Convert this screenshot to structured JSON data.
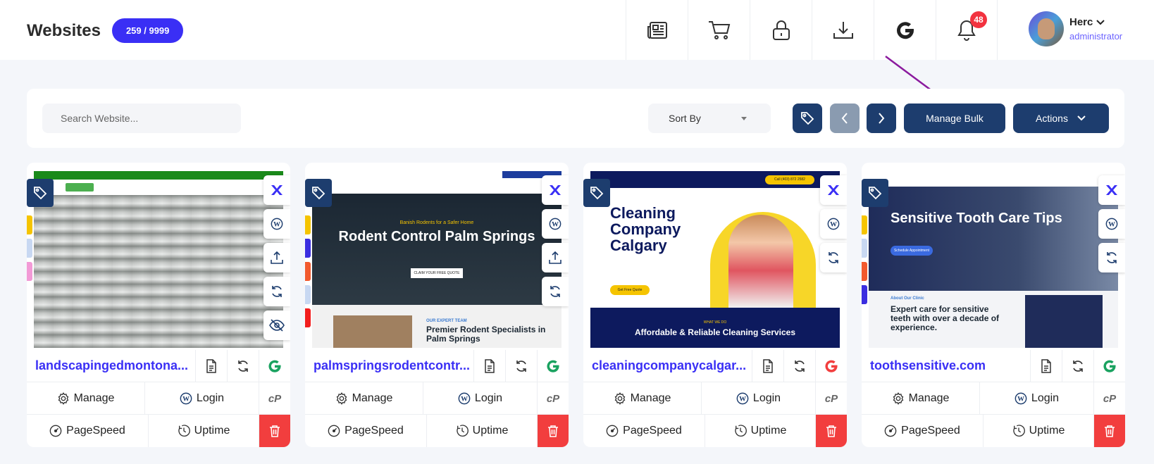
{
  "header": {
    "title": "Websites",
    "count": "259 / 9999",
    "notifications": "48",
    "user": {
      "name": "Herc",
      "role": "administrator"
    },
    "icons": [
      "newspaper-icon",
      "cart-icon",
      "lock-icon",
      "download-icon",
      "google-icon",
      "bell-icon"
    ]
  },
  "toolbar": {
    "search_placeholder": "Search Website...",
    "sort_label": "Sort By",
    "manage_bulk": "Manage Bulk",
    "actions": "Actions"
  },
  "cards": [
    {
      "domain": "landscapingedmontona...",
      "preview": {
        "headline": ""
      },
      "google_status_color": "#1aa260",
      "stripes": [
        "#f5c400",
        "#c8d8f2",
        "#f29ad6"
      ],
      "side_actions": [
        "x-logo-icon",
        "wordpress-icon",
        "upload-icon",
        "refresh-icon",
        "eye-slash-icon"
      ]
    },
    {
      "domain": "palmspringsrodentcontr...",
      "preview": {
        "headline": "Rodent Control Palm Springs",
        "kicker": "Banish Rodents for a Safer Home",
        "cta": "CLAIM YOUR FREE QUOTE",
        "section_label": "OUR EXPERT TEAM",
        "section_title": "Premier Rodent Specialists in Palm Springs"
      },
      "google_status_color": "#1aa260",
      "stripes": [
        "#f5c400",
        "#3b2ee0",
        "#f25a2e",
        "#c8d8f2",
        "#f21e1e"
      ],
      "side_actions": [
        "x-logo-icon",
        "wordpress-icon",
        "upload-icon",
        "refresh-icon"
      ]
    },
    {
      "domain": "cleaningcompanycalgar...",
      "preview": {
        "headline": "Cleaning Company Calgary",
        "cta": "Get Free Quote",
        "section_label": "WHAT WE DO",
        "section_title": "Affordable & Reliable Cleaning Services",
        "phone": "Call (403) 872 2582"
      },
      "google_status_color": "#f23e3e",
      "stripes": [],
      "side_actions": [
        "x-logo-icon",
        "wordpress-icon",
        "refresh-icon"
      ]
    },
    {
      "domain": "toothsensitive.com",
      "preview": {
        "headline": "Sensitive Tooth Care Tips",
        "cta": "Schedule Appointment",
        "section_label": "About Our Clinic",
        "section_title": "Expert care for sensitive teeth with over a decade of experience."
      },
      "google_status_color": "#1aa260",
      "stripes": [
        "#f5c400",
        "#c8d8f2",
        "#f25a2e",
        "#3b2ee0"
      ],
      "side_actions": [
        "x-logo-icon",
        "wordpress-icon",
        "refresh-icon"
      ]
    }
  ],
  "card_labels": {
    "manage": "Manage",
    "login": "Login",
    "pagespeed": "PageSpeed",
    "uptime": "Uptime"
  },
  "colors": {
    "accent": "#3a2ff5",
    "navy": "#1d3d6e",
    "danger": "#f23e3e",
    "annotation_arrow": "#8b1a9e"
  }
}
